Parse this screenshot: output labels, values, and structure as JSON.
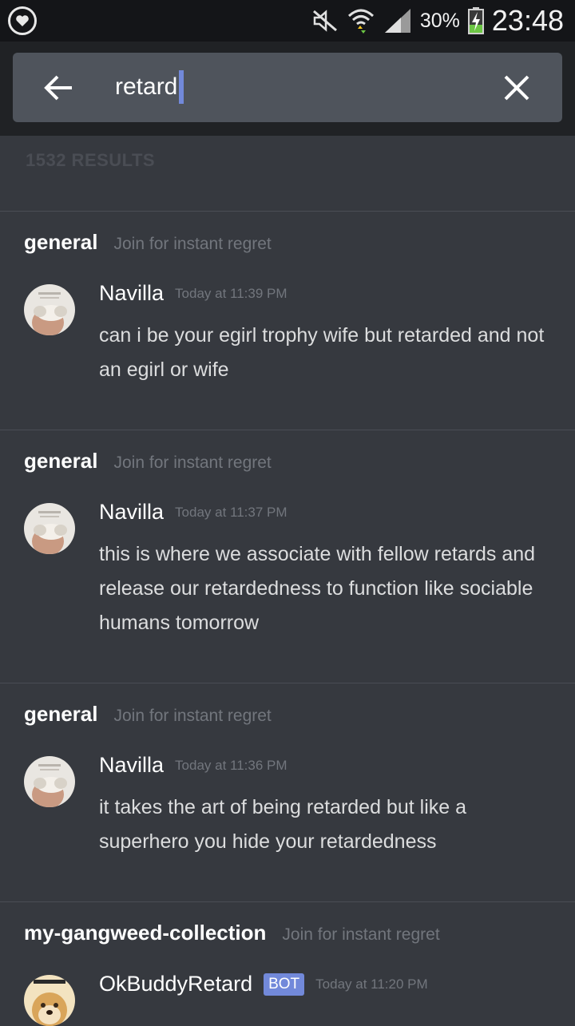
{
  "status_bar": {
    "battery": "30%",
    "time": "23:48",
    "icons": [
      "discord-icon",
      "mute-icon",
      "wifi-icon",
      "signal-icon",
      "battery-charging-icon"
    ]
  },
  "search": {
    "value": "retard",
    "back_icon": "arrow-left-icon",
    "clear_icon": "close-icon"
  },
  "results_count": "1532 RESULTS",
  "results": [
    {
      "channel": "general",
      "topic": "Join for instant regret",
      "author": "Navilla",
      "time": "Today at 11:39 PM",
      "message": "can i be your egirl trophy wife but retarded and not an egirl or wife"
    },
    {
      "channel": "general",
      "topic": "Join for instant regret",
      "author": "Navilla",
      "time": "Today at 11:37 PM",
      "message": "this is where we associate with fellow retards and release our retardedness to function like sociable humans tomorrow"
    },
    {
      "channel": "general",
      "topic": "Join for instant regret",
      "author": "Navilla",
      "time": "Today at 11:36 PM",
      "message": "it takes the art of being retarded but like a superhero you hide your retardedness"
    },
    {
      "channel": "my-gangweed-collection",
      "topic": "Join for instant regret",
      "author": "OkBuddyRetard",
      "bot_tag": "BOT",
      "time": "Today at 11:20 PM",
      "message": ""
    }
  ],
  "colors": {
    "background": "#36393f",
    "search_bar": "#4f545c",
    "accent": "#7289da"
  }
}
